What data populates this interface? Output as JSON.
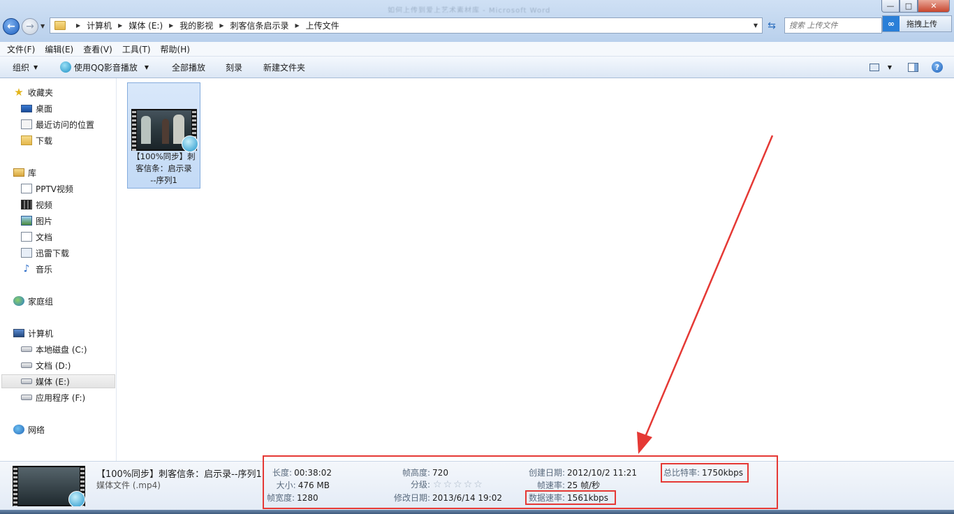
{
  "window": {
    "title_blurred": "如何上传到爱上艺术素材库 - Microsoft Word",
    "controls": {
      "minimize": "—",
      "maximize": "□",
      "close": "✕"
    }
  },
  "address": {
    "crumbs": [
      "计算机",
      "媒体 (E:)",
      "我的影视",
      "刺客信条启示录",
      "上传文件"
    ],
    "search_placeholder": "搜索 上传文件",
    "upload_label": "拖拽上传"
  },
  "menu": [
    "文件(F)",
    "编辑(E)",
    "查看(V)",
    "工具(T)",
    "帮助(H)"
  ],
  "toolbar": {
    "organize": "组织",
    "qq_play": "使用QQ影音播放",
    "play_all": "全部播放",
    "burn": "刻录",
    "new_folder": "新建文件夹"
  },
  "nav": {
    "favorites": {
      "label": "收藏夹",
      "items": [
        "桌面",
        "最近访问的位置",
        "下载"
      ]
    },
    "libraries": {
      "label": "库",
      "items": [
        "PPTV视频",
        "视频",
        "图片",
        "文档",
        "迅雷下载",
        "音乐"
      ]
    },
    "homegroup": "家庭组",
    "computer": {
      "label": "计算机",
      "items": [
        "本地磁盘 (C:)",
        "文档 (D:)",
        "媒体 (E:)",
        "应用程序 (F:)"
      ]
    },
    "network": "网络"
  },
  "file": {
    "name_line1": "【100%同步】刺",
    "name_line2": "客信条：启示录",
    "name_line3": "--序列1"
  },
  "details": {
    "title": "【100%同步】刺客信条：启示录--序列1",
    "type": "媒体文件 (.mp4)",
    "props": {
      "length": {
        "k": "长度:",
        "v": "00:38:02"
      },
      "size": {
        "k": "大小:",
        "v": "476 MB"
      },
      "frame_width": {
        "k": "帧宽度:",
        "v": "1280"
      },
      "frame_height": {
        "k": "帧高度:",
        "v": "720"
      },
      "rating": {
        "k": "分级:",
        "stars": 0,
        "of": 5
      },
      "modified": {
        "k": "修改日期:",
        "v": "2013/6/14 19:02"
      },
      "created": {
        "k": "创建日期:",
        "v": "2012/10/2 11:21"
      },
      "frame_rate": {
        "k": "帧速率:",
        "v": "25 帧/秒"
      },
      "data_rate": {
        "k": "数据速率:",
        "v": "1561kbps"
      },
      "total_bitrate": {
        "k": "总比特率:",
        "v": "1750kbps"
      }
    }
  },
  "colors": {
    "annotation": "#e53935",
    "selection": "#c3daf6"
  }
}
